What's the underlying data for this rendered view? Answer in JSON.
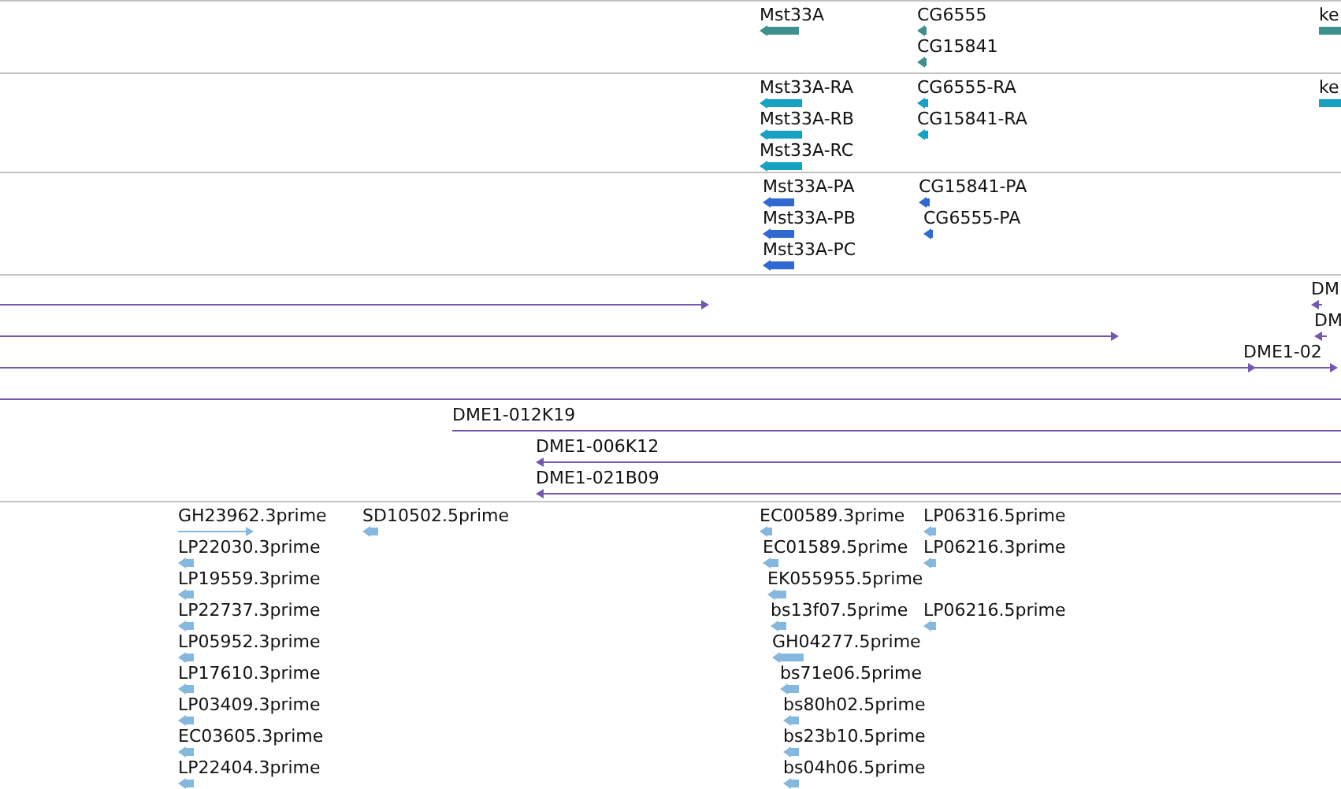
{
  "tracks": [
    {
      "kind": "gene",
      "color": "#3f8f8f",
      "features": [
        {
          "label": "Mst33A",
          "reverse": true
        },
        {
          "label": "CG6555",
          "reverse": true
        },
        {
          "label": "CG15841",
          "reverse": true
        },
        {
          "label": "ke",
          "reverse": false
        }
      ]
    },
    {
      "kind": "gene",
      "color": "#17a2c4",
      "features": [
        {
          "label": "Mst33A-RA",
          "reverse": true
        },
        {
          "label": "Mst33A-RB",
          "reverse": true
        },
        {
          "label": "Mst33A-RC",
          "reverse": true
        },
        {
          "label": "CG6555-RA",
          "reverse": true
        },
        {
          "label": "CG15841-RA",
          "reverse": true
        },
        {
          "label": "ke",
          "reverse": false
        }
      ]
    },
    {
      "kind": "gene",
      "color": "#3169d4",
      "features": [
        {
          "label": "Mst33A-PA",
          "reverse": true
        },
        {
          "label": "Mst33A-PB",
          "reverse": true
        },
        {
          "label": "Mst33A-PC",
          "reverse": true
        },
        {
          "label": "CG15841-PA",
          "reverse": true
        },
        {
          "label": "CG6555-PA",
          "reverse": true
        }
      ]
    },
    {
      "kind": "clone",
      "color": "#7657b0",
      "features": [
        {
          "reverse": false
        },
        {
          "label": "DM",
          "reverse": true
        },
        {
          "reverse": false
        },
        {
          "label": "DM",
          "reverse": true
        },
        {
          "reverse": false
        },
        {
          "label": "DME1-02",
          "reverse": false
        },
        {
          "reverse": false
        },
        {
          "label": "DME1-012K19",
          "reverse": false
        },
        {
          "label": "DME1-006K12",
          "reverse": true
        },
        {
          "label": "DME1-021B09",
          "reverse": true
        }
      ]
    },
    {
      "kind": "est",
      "color": "#84b8de",
      "features": [
        {
          "label": "GH23962.3prime",
          "reverse": false
        },
        {
          "label": "LP22030.3prime",
          "reverse": true
        },
        {
          "label": "LP19559.3prime",
          "reverse": true
        },
        {
          "label": "LP22737.3prime",
          "reverse": true
        },
        {
          "label": "LP05952.3prime",
          "reverse": true
        },
        {
          "label": "LP17610.3prime",
          "reverse": true
        },
        {
          "label": "LP03409.3prime",
          "reverse": true
        },
        {
          "label": "EC03605.3prime",
          "reverse": true
        },
        {
          "label": "LP22404.3prime",
          "reverse": true
        },
        {
          "label": "SD10502.5prime",
          "reverse": true
        },
        {
          "label": "EC00589.3prime",
          "reverse": true
        },
        {
          "label": "EC01589.5prime",
          "reverse": true
        },
        {
          "label": "EK055955.5prime",
          "reverse": true
        },
        {
          "label": "bs13f07.5prime",
          "reverse": true
        },
        {
          "label": "GH04277.5prime",
          "reverse": true
        },
        {
          "label": "bs71e06.5prime",
          "reverse": true
        },
        {
          "label": "bs80h02.5prime",
          "reverse": true
        },
        {
          "label": "bs23b10.5prime",
          "reverse": true
        },
        {
          "label": "bs04h06.5prime",
          "reverse": true
        },
        {
          "label": "LP06316.5prime",
          "reverse": true
        },
        {
          "label": "LP06216.3prime",
          "reverse": true
        },
        {
          "label": "LP06216.5prime",
          "reverse": true
        }
      ]
    }
  ]
}
